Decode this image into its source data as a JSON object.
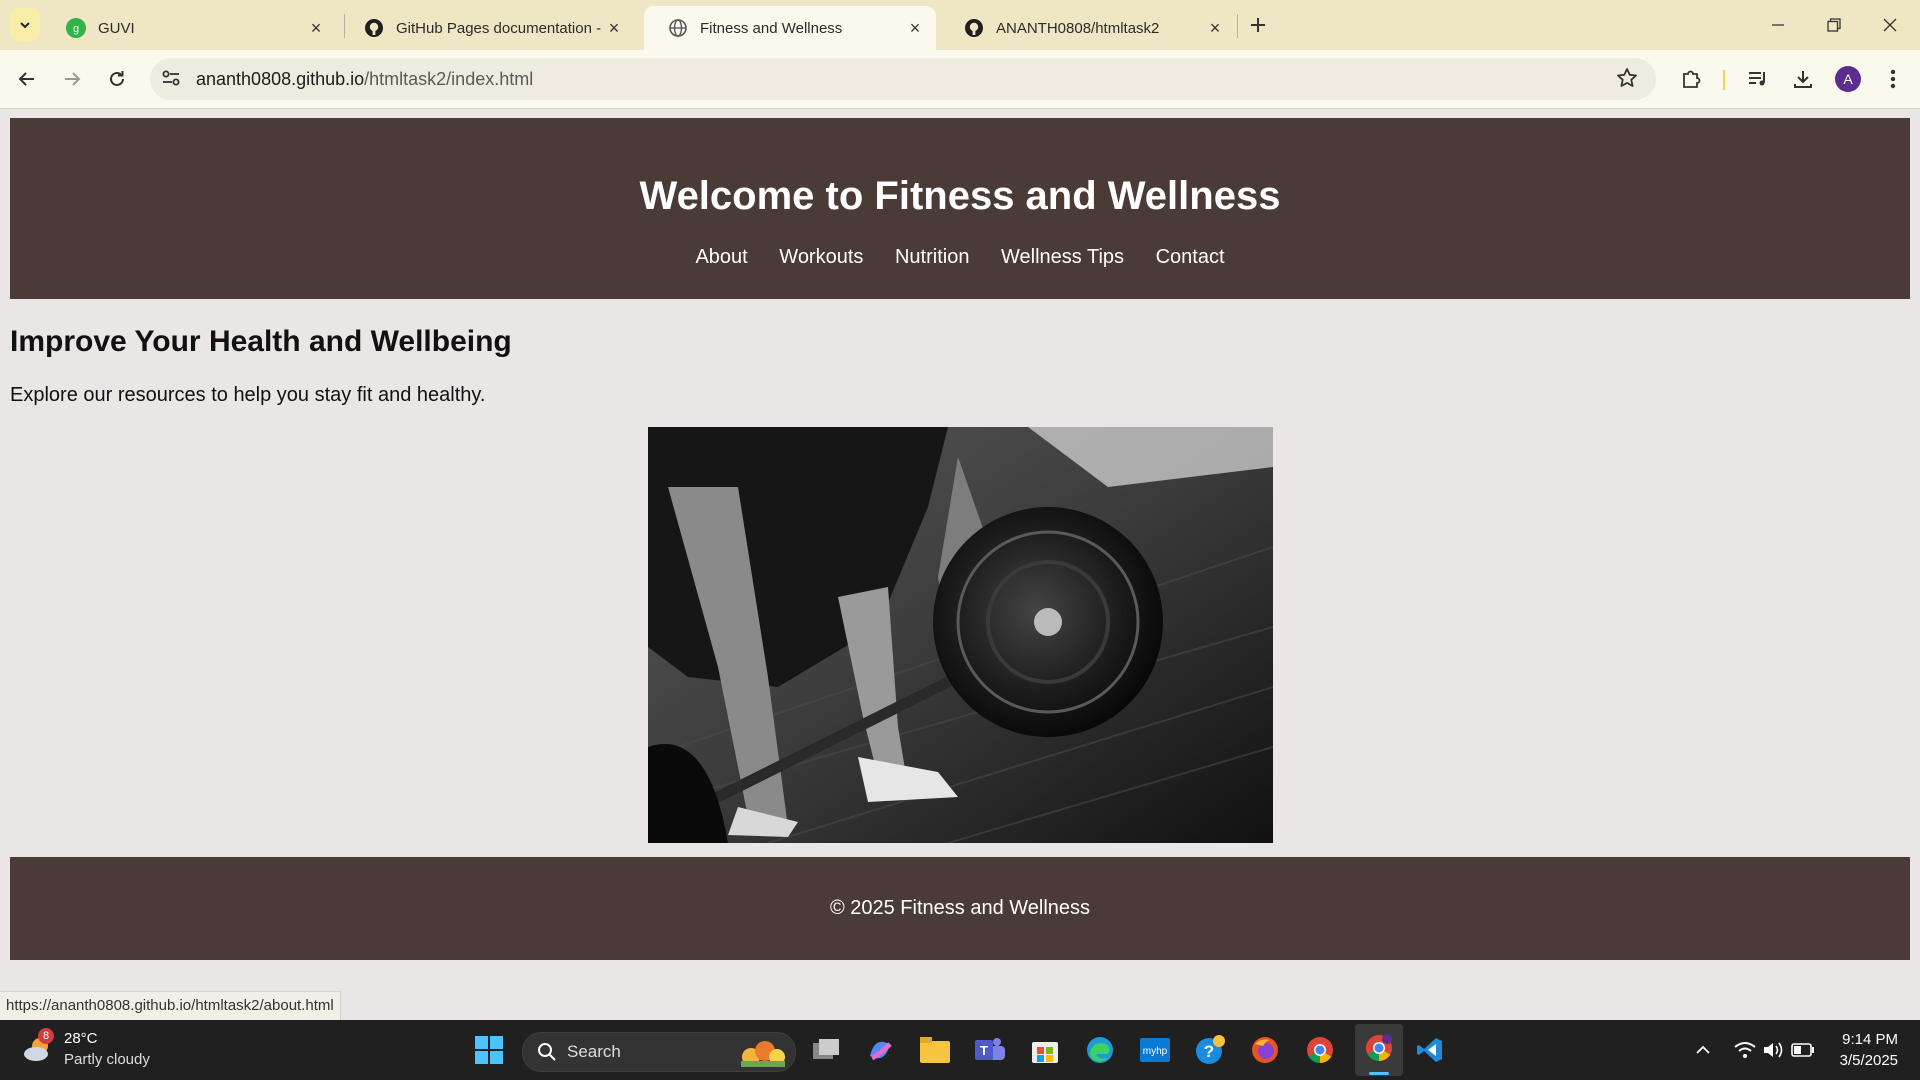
{
  "browser": {
    "tabs": [
      {
        "title": "GUVI",
        "badge": "g"
      },
      {
        "title": "GitHub Pages documentation - "
      },
      {
        "title": "Fitness and Wellness"
      },
      {
        "title": "ANANTH0808/htmltask2"
      }
    ],
    "url_host": "ananth0808.github.io",
    "url_path": "/htmltask2/index.html",
    "profile_initial": "A",
    "status_url": "https://ananth0808.github.io/htmltask2/about.html"
  },
  "page": {
    "title": "Welcome to Fitness and Wellness",
    "nav": [
      "About",
      "Workouts",
      "Nutrition",
      "Wellness Tips",
      "Contact"
    ],
    "heading": "Improve Your Health and Wellbeing",
    "intro": "Explore our resources to help you stay fit and healthy.",
    "footer": "© 2025 Fitness and Wellness"
  },
  "taskbar": {
    "weather_temp": "28°C",
    "weather_desc": "Partly cloudy",
    "weather_badge": "8",
    "search_label": "Search",
    "time": "9:14 PM",
    "date": "3/5/2025"
  },
  "colors": {
    "header_bg": "#4a3b36",
    "page_bg": "#e9e6e5",
    "tabstrip_bg": "#efe7c4"
  }
}
